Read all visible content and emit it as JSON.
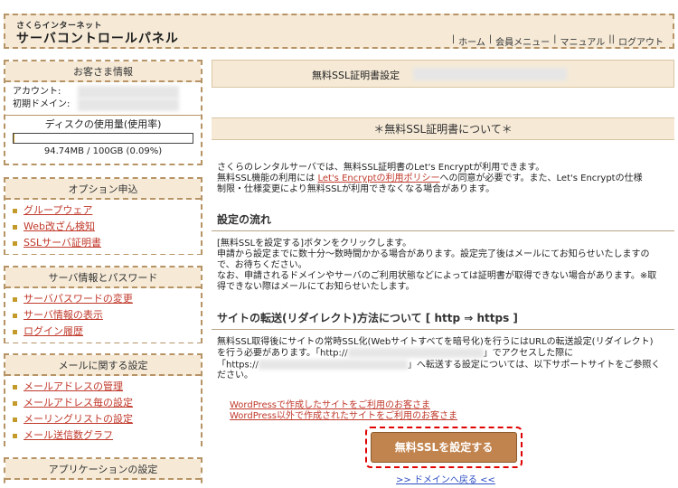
{
  "header": {
    "brand_small": "さくらインターネット",
    "brand_main": "サーバコントロールパネル",
    "nav": [
      "ホーム",
      "会員メニュー",
      "マニュアル",
      "ログアウト"
    ]
  },
  "sidebar": {
    "customer": {
      "title": "お客さま情報",
      "account_label": "アカウント:",
      "domain_label": "初期ドメイン:",
      "disk_label": "ディスクの使用量(使用率)",
      "disk_value": "94.74MB / 100GB (0.09%)",
      "disk_usage_percent": 0.09
    },
    "options": {
      "title": "オプション申込",
      "items": [
        "グループウェア",
        "Web改ざん検知",
        "SSLサーバ証明書"
      ]
    },
    "server": {
      "title": "サーバ情報とパスワード",
      "items": [
        "サーバパスワードの変更",
        "サーバ情報の表示",
        "ログイン履歴"
      ]
    },
    "mail": {
      "title": "メールに関する設定",
      "items": [
        "メールアドレスの管理",
        "メールアドレス毎の設定",
        "メーリングリストの設定",
        "メール送信数グラフ"
      ]
    },
    "apps": {
      "title": "アプリケーションの設定"
    }
  },
  "main": {
    "title": "無料SSL証明書設定",
    "about_header": "＊無料SSL証明書について＊",
    "intro_line1": "さくらのレンタルサーバでは、無料SSL証明書のLet's Encryptが利用できます。",
    "intro_line2_a": "無料SSL機能の利用には",
    "intro_policy_link": "Let's Encryptの利用ポリシー",
    "intro_line2_b": "への同意が必要です。また、Let's Encryptの仕様",
    "intro_line3": "制限・仕様変更により無料SSLが利用できなくなる場合があります。",
    "flow_title": "設定の流れ",
    "flow_lines": [
      "[無料SSLを設定する]ボタンをクリックします。",
      "申請から設定までに数十分～数時間かかる場合があります。設定完了後はメールにてお知らせいたしますの",
      "で、お待ちください。",
      "なお、申請されるドメインやサーバのご利用状態などによっては証明書が取得できない場合があります。※取",
      "得できない際はメールにてお知らせいたします。"
    ],
    "redirect_title": "サイトの転送(リダイレクト)方法について [ http ⇒ https ]",
    "redirect_line1": "無料SSL取得後にサイトの常時SSL化(Webサイトすべてを暗号化)を行うにはURLの転送設定(リダイレクト)",
    "redirect_line2_a": "を行う必要があります。「http://",
    "redirect_line2_b": "」でアクセスした際に",
    "redirect_line3_a": "「https://",
    "redirect_line3_b": "」へ転送する設定については、以下サポートサイトをご参照く",
    "redirect_line4": "ださい。",
    "help_link_1": "WordPressで作成したサイトをご利用のお客さま",
    "help_link_2": "WordPress以外で作成されたサイトをご利用のお客さま",
    "cta": "無料SSLを設定する",
    "back": ">> ドメインへ戻る <<"
  }
}
